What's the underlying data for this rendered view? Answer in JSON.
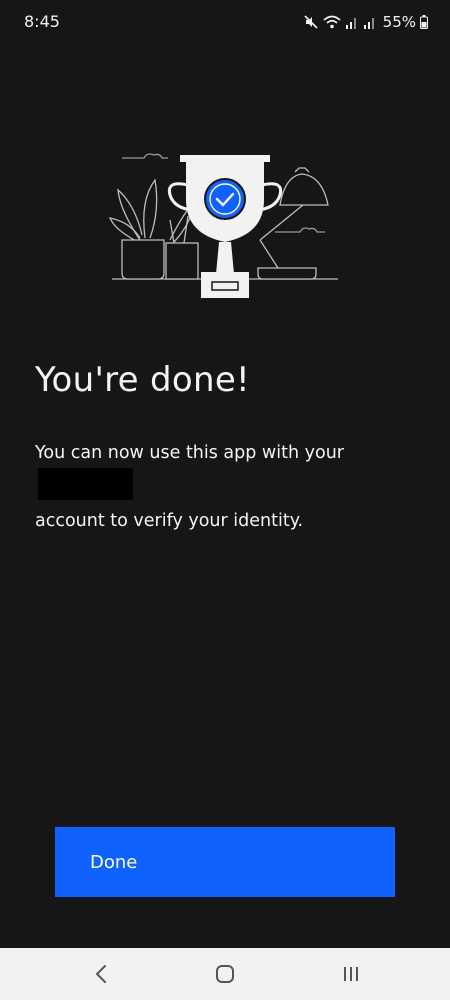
{
  "status_bar": {
    "time": "8:45",
    "battery": "55%",
    "icons": [
      "mute-icon",
      "wifi-icon",
      "signal-icon",
      "signal-icon",
      "battery-icon"
    ]
  },
  "illustration": {
    "icon": "trophy-checkmark-icon",
    "accent_color": "#0f62fe"
  },
  "content": {
    "title": "You're done!",
    "description_part1": "You can now use this app with your",
    "description_part2": "account to verify your identity."
  },
  "actions": {
    "done_label": "Done",
    "button_color": "#0f62fe"
  },
  "nav_bar": {
    "icons": [
      "back-icon",
      "home-icon",
      "recent-apps-icon"
    ]
  }
}
